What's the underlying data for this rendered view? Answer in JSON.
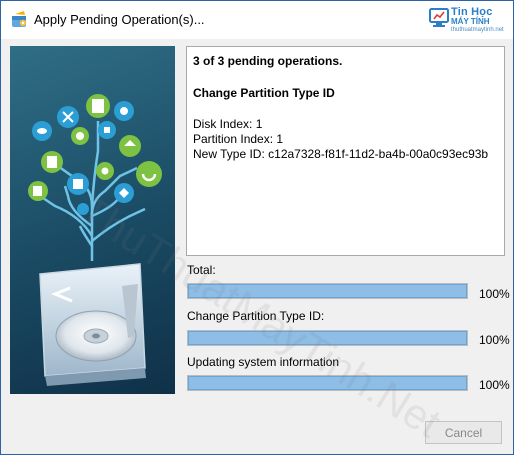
{
  "window": {
    "title": "Apply Pending Operation(s)..."
  },
  "watermark": {
    "name_line1": "Tin Học",
    "name_line2": "MÁY TÍNH",
    "url": "thuthuatmaytinh.net",
    "diagonal_text": "ThuThuatMayTinh.Net"
  },
  "info": {
    "heading": "3 of 3 pending operations.",
    "operation_title": "Change Partition Type ID",
    "disk_index": "Disk Index: 1",
    "partition_index": "Partition Index: 1",
    "new_type_id": "New Type ID: c12a7328-f81f-11d2-ba4b-00a0c93ec93b"
  },
  "progress": [
    {
      "label": "Total:",
      "percent": 100,
      "percent_text": "100%"
    },
    {
      "label": "Change Partition Type ID:",
      "percent": 100,
      "percent_text": "100%"
    },
    {
      "label": "Updating system information",
      "percent": 100,
      "percent_text": "100%"
    }
  ],
  "buttons": {
    "cancel_label": "Cancel"
  },
  "colors": {
    "window_border": "#2b63a8",
    "progress_fill": "#8ebde6",
    "panel_dark": "#0f3148",
    "leaf_green": "#7dc243"
  },
  "icons": [
    "app-icon",
    "disk-tree-illustration"
  ]
}
